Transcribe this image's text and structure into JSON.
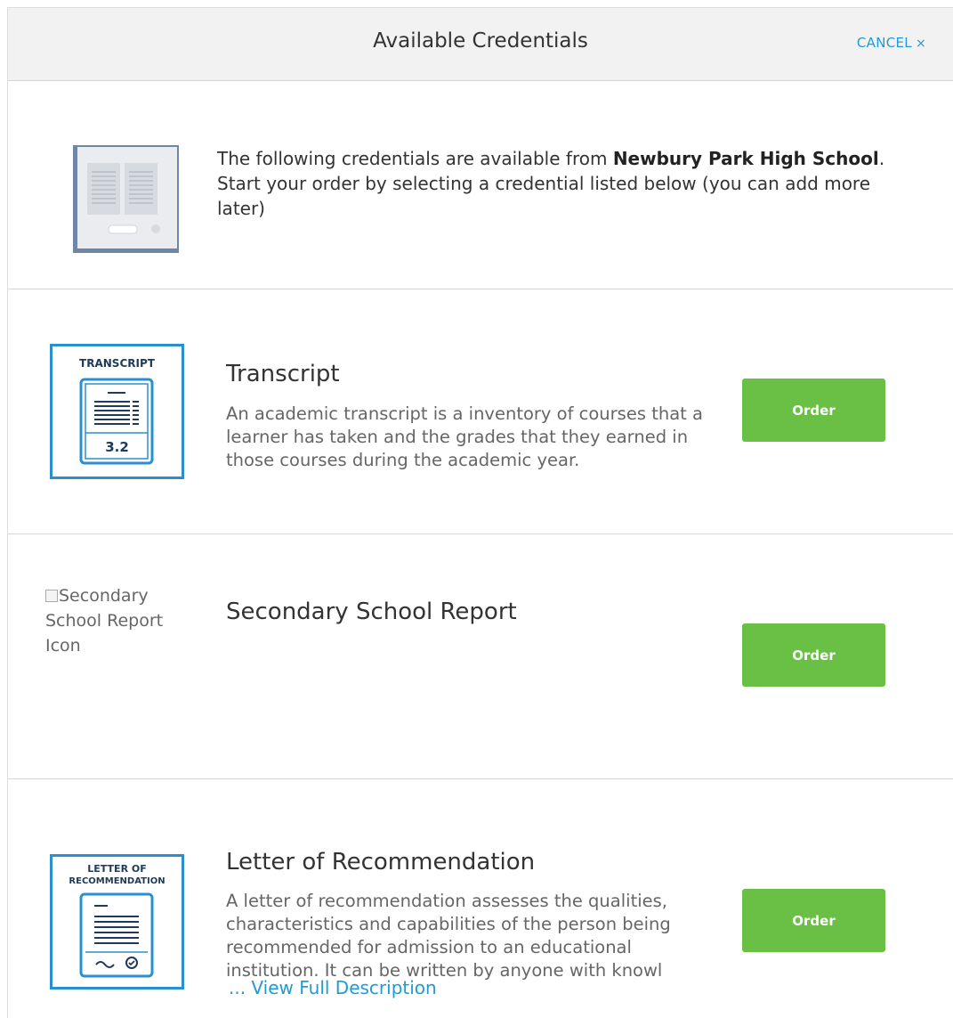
{
  "header": {
    "title": "Available Credentials",
    "cancel_label": "CANCEL",
    "cancel_icon": "×"
  },
  "intro": {
    "text_before": "The following credentials are available from ",
    "school": "Newbury Park High School",
    "text_after": ". Start your order by selecting a credential listed below (you can add more later)"
  },
  "credentials": [
    {
      "title": "Transcript",
      "icon_label": "TRANSCRIPT",
      "icon_value": "3.2",
      "description": "An academic transcript is a inventory of courses that a learner has taken and the grades that they earned in those courses during the academic year.",
      "order_label": "Order"
    },
    {
      "title": "Secondary School Report",
      "icon_alt": "Secondary School Report Icon",
      "description": "",
      "order_label": "Order"
    },
    {
      "title": "Letter of Recommendation",
      "icon_label_line1": "LETTER OF",
      "icon_label_line2": "RECOMMENDATION",
      "description": "A letter of recommendation assesses the qualities, characteristics and capabilities of the person being recommended for admission to an educational institution. It can be written by anyone with knowl",
      "view_full_label": "... View Full Description",
      "order_label": "Order"
    }
  ],
  "colors": {
    "accent_blue": "#1e9bd7",
    "order_green": "#6abf45",
    "icon_blue": "#2a8fd0"
  }
}
